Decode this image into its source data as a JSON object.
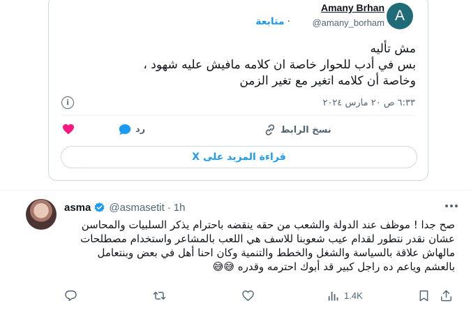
{
  "embed": {
    "avatar_letter": "A",
    "author_name": "Amany Brhan",
    "author_handle": "@amany_borham",
    "follow_label": "متابعة",
    "text_line1": "مش تأليه",
    "text_line2": "بس في أدب للحوار خاصة ان كلامه مافيش عليه شهود ،",
    "text_line3": "وخاصة أن كلامه اتغير مع تغير الزمن",
    "timestamp": "٦:٣٣ ص ٢٠ مارس ٢٠٢٤",
    "reply_label": "رد",
    "copy_link_label": "نسخ الرابط",
    "read_more_label": "قراءة المزيد على X"
  },
  "tweet": {
    "author_name": "asma",
    "author_handle": "@asmasetit",
    "separator": "·",
    "time": "1h",
    "text": "صح جدا ! موظف عند الدولة والشعب من حقه ينقضه باحترام يذكر السلبيات والمحاسن عشان نقدر نتطور لقدام عيب شعوبنا للاسف هي اللعب بالمشاعر واستخدام مصطلحات مالهاش علاقة بالسياسة والشغل والخطط والتنمية وكان احنا أهل في بعض وبنتعامل بالعشم وياعم ده راجل كبير قد أبوك احترمه وقدره 😅😅",
    "views": "1.4K"
  },
  "colors": {
    "accent": "#1d9bf0",
    "like_pink": "#f91880",
    "muted": "#536471",
    "avatar_bg": "#1f6b78"
  },
  "icons": [
    "info-icon",
    "heart-icon",
    "reply-bubble-icon",
    "link-icon",
    "verified-badge-icon",
    "more-icon",
    "reply-icon",
    "retweet-icon",
    "like-icon",
    "views-icon",
    "bookmark-icon",
    "share-icon"
  ]
}
